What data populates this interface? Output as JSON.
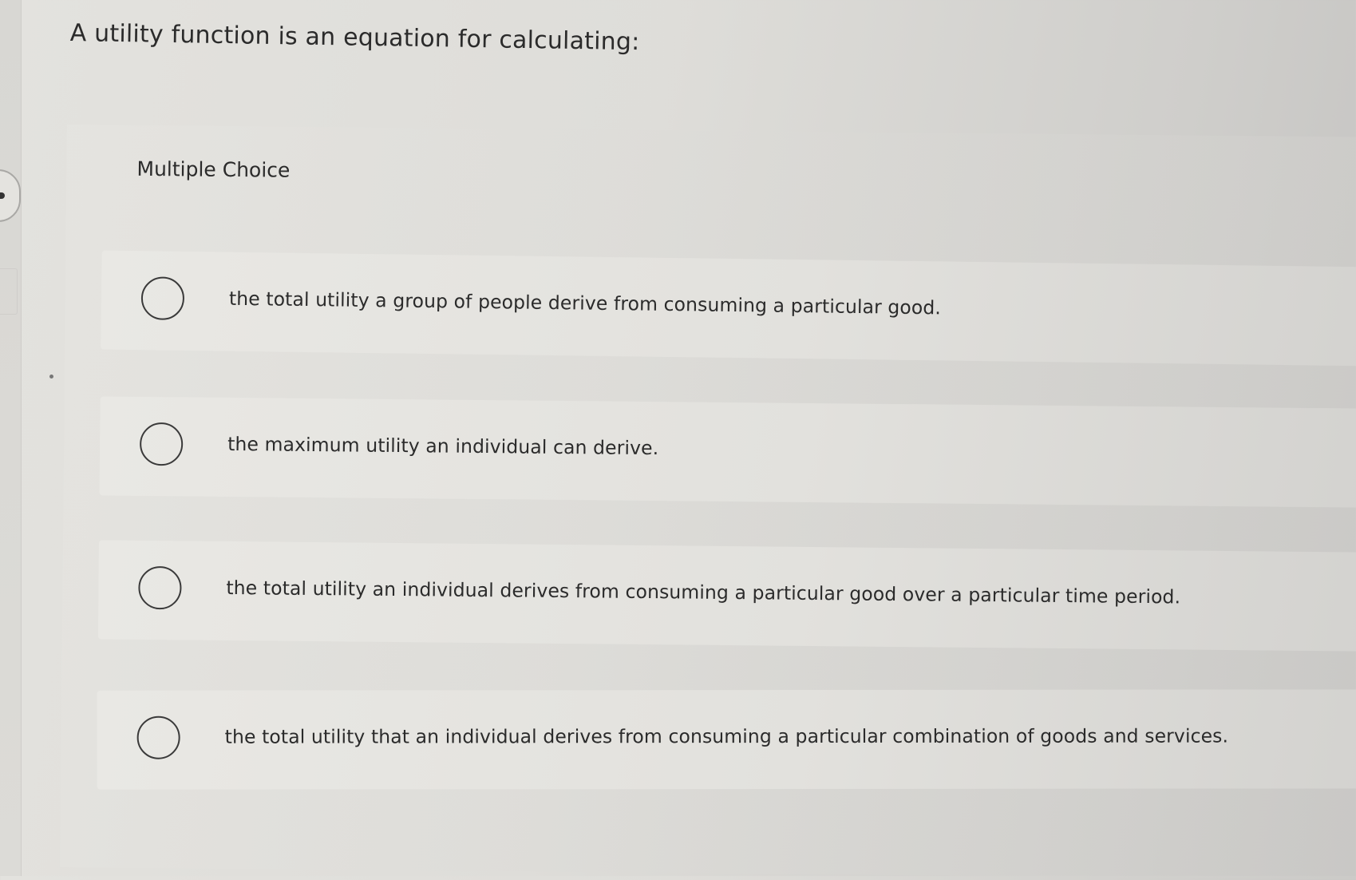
{
  "question": {
    "text": "A utility function is an equation for calculating:"
  },
  "choice_block": {
    "label": "Multiple Choice",
    "options": [
      {
        "text": "the total utility a group of people derive from consuming a particular good."
      },
      {
        "text": "the maximum utility an individual can derive."
      },
      {
        "text": "the total utility an individual derives from consuming a particular good over a particular time period."
      },
      {
        "text": "the total utility that an individual derives from consuming a particular combination of goods and services."
      }
    ]
  }
}
